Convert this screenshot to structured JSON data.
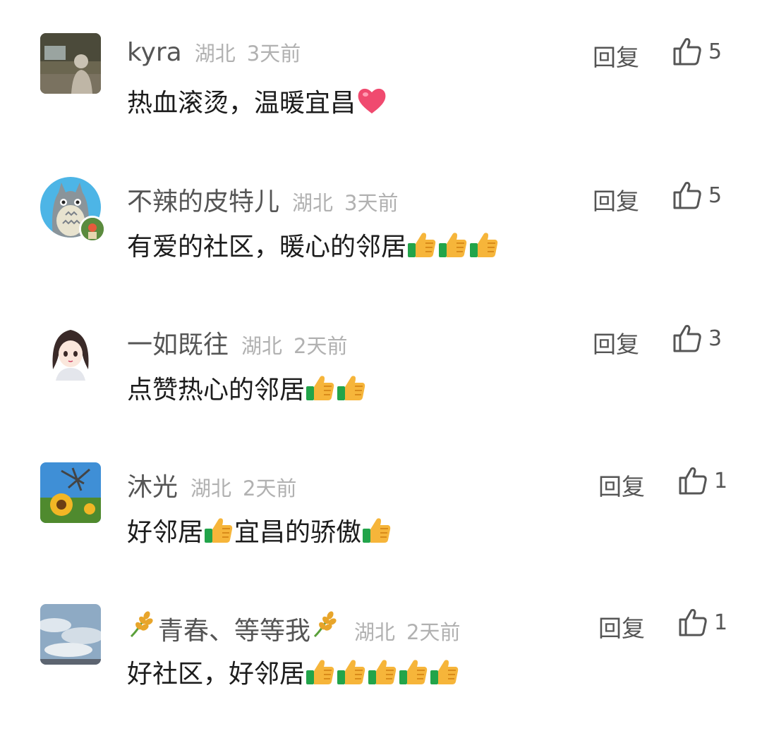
{
  "comments": [
    {
      "name": "kyra",
      "location": "湖北",
      "time": "3天前",
      "text": "热血滚烫，温暖宜昌",
      "emojis": [
        "heart"
      ],
      "reply_label": "回复",
      "likes": "5"
    },
    {
      "name": "不辣的皮特儿",
      "location": "湖北",
      "time": "3天前",
      "text": "有爱的社区，暖心的邻居",
      "emojis": [
        "thumbs-up",
        "thumbs-up",
        "thumbs-up"
      ],
      "reply_label": "回复",
      "likes": "5"
    },
    {
      "name": "一如既往",
      "location": "湖北",
      "time": "2天前",
      "text": "点赞热心的邻居",
      "emojis": [
        "thumbs-up",
        "thumbs-up"
      ],
      "reply_label": "回复",
      "likes": "3"
    },
    {
      "name": "沐光",
      "location": "湖北",
      "time": "2天前",
      "text_parts": [
        "好邻居",
        "宜昌的骄傲"
      ],
      "reply_label": "回复",
      "likes": "1"
    },
    {
      "name": "青春、等等我",
      "location": "湖北",
      "time": "2天前",
      "text": "好社区，好邻居",
      "emojis": [
        "thumbs-up",
        "thumbs-up",
        "thumbs-up",
        "thumbs-up",
        "thumbs-up"
      ],
      "reply_label": "回复",
      "likes": "1"
    }
  ],
  "colors": {
    "name": "#555555",
    "meta": "#b1b1b1",
    "body_text": "#1c1c1c",
    "thumb_yellow": "#f6b53a",
    "cuff_green": "#22a44a",
    "heart_pink": "#f04a6f"
  }
}
